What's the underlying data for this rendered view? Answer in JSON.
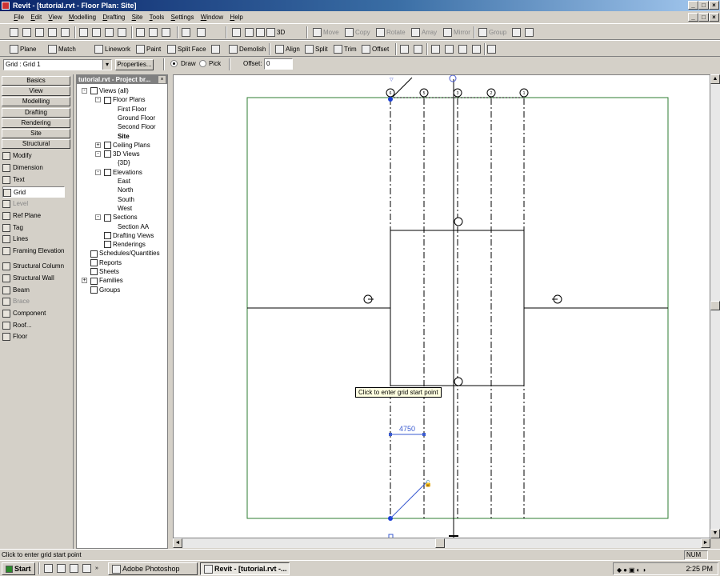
{
  "window": {
    "title": "Revit - [tutorial.rvt - Floor Plan: Site]"
  },
  "menu": [
    "File",
    "Edit",
    "View",
    "Modelling",
    "Drafting",
    "Site",
    "Tools",
    "Settings",
    "Window",
    "Help"
  ],
  "toolbar1": {
    "view_3d": "3D",
    "move": "Move",
    "copy": "Copy",
    "rotate": "Rotate",
    "array": "Array",
    "mirror": "Mirror",
    "group": "Group"
  },
  "toolbar2": {
    "plane": "Plane",
    "match": "Match",
    "linework": "Linework",
    "paint": "Paint",
    "split_face": "Split Face",
    "demolish": "Demolish",
    "align": "Align",
    "split": "Split",
    "trim": "Trim",
    "offset": "Offset"
  },
  "options": {
    "type_selector": "Grid : Grid 1",
    "properties": "Properties...",
    "draw": "Draw",
    "pick": "Pick",
    "offset_label": "Offset:",
    "offset_value": "0"
  },
  "design_bar": {
    "tabs": [
      "Basics",
      "View",
      "Modelling",
      "Drafting",
      "Rendering",
      "Site",
      "Structural"
    ],
    "tools": [
      {
        "label": "Modify",
        "enabled": true
      },
      {
        "label": "Dimension",
        "enabled": true
      },
      {
        "label": "Text",
        "enabled": true
      },
      {
        "label": "Grid",
        "enabled": true,
        "active": true
      },
      {
        "label": "Level",
        "enabled": false
      },
      {
        "label": "Ref Plane",
        "enabled": true
      },
      {
        "label": "Tag",
        "enabled": true
      },
      {
        "label": "Lines",
        "enabled": true
      },
      {
        "label": "Framing Elevation",
        "enabled": true
      },
      {
        "label": "Structural Column",
        "enabled": true
      },
      {
        "label": "Structural Wall",
        "enabled": true
      },
      {
        "label": "Beam",
        "enabled": true
      },
      {
        "label": "Brace",
        "enabled": false
      },
      {
        "label": "Component",
        "enabled": true
      },
      {
        "label": "Roof...",
        "enabled": true
      },
      {
        "label": "Floor",
        "enabled": true
      }
    ]
  },
  "project_browser": {
    "title": "tutorial.rvt - Project br...",
    "nodes": [
      {
        "label": "Views (all)",
        "level": 0,
        "exp": "-"
      },
      {
        "label": "Floor Plans",
        "level": 1,
        "exp": "-"
      },
      {
        "label": "First Floor",
        "level": 2
      },
      {
        "label": "Ground Floor",
        "level": 2
      },
      {
        "label": "Second Floor",
        "level": 2
      },
      {
        "label": "Site",
        "level": 2,
        "bold": true
      },
      {
        "label": "Ceiling Plans",
        "level": 1,
        "exp": "+"
      },
      {
        "label": "3D Views",
        "level": 1,
        "exp": "-"
      },
      {
        "label": "{3D}",
        "level": 2
      },
      {
        "label": "Elevations",
        "level": 1,
        "exp": "-"
      },
      {
        "label": "East",
        "level": 2
      },
      {
        "label": "North",
        "level": 2
      },
      {
        "label": "South",
        "level": 2
      },
      {
        "label": "West",
        "level": 2
      },
      {
        "label": "Sections",
        "level": 1,
        "exp": "-"
      },
      {
        "label": "Section AA",
        "level": 2
      },
      {
        "label": "Drafting Views",
        "level": 1
      },
      {
        "label": "Renderings",
        "level": 1
      },
      {
        "label": "Schedules/Quantities",
        "level": 0
      },
      {
        "label": "Reports",
        "level": 0
      },
      {
        "label": "Sheets",
        "level": 0
      },
      {
        "label": "Families",
        "level": 0,
        "exp": "+"
      },
      {
        "label": "Groups",
        "level": 0
      }
    ]
  },
  "canvas": {
    "grid_bubbles": [
      "6",
      "5",
      "3",
      "2",
      "1"
    ],
    "dimension": "4750",
    "tooltip": "Click to enter grid start point"
  },
  "status": {
    "message": "Click to enter grid start point",
    "num": "NUM"
  },
  "taskbar": {
    "start": "Start",
    "tasks": [
      "Adobe Photoshop",
      "Revit - [tutorial.rvt -..."
    ],
    "clock": "2:25 PM"
  }
}
